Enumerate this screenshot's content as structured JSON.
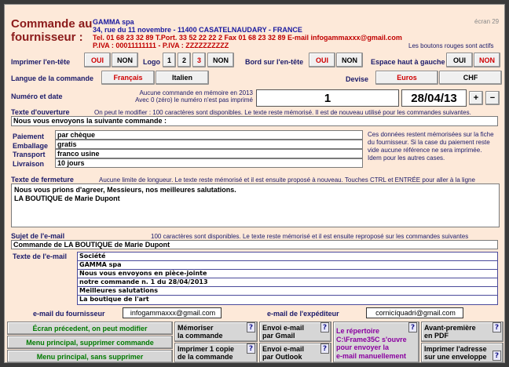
{
  "header": {
    "title_line1": "Commande au",
    "title_line2": "fournisseur :",
    "company": "GAMMA spa",
    "address": "34, rue du 11 novembre - 11400  CASATELNAUDARY  -  FRANCE",
    "phones": "Tel. 01 68 23 32 89   T.Port. 33 52 22 22 2   Fax 01 68 23 32 89    E-mail infogammaxxx@gmail.com",
    "piva": "P.IVA : 00011111111    -   P.IVA : ZZZZZZZZZZ",
    "screen_no": "écran 29",
    "red_note": "Les boutons rouges sont actifs"
  },
  "options": {
    "print_header_label": "Imprimer l'en-tête",
    "oui": "OUI",
    "non": "NON",
    "logo_label": "Logo",
    "logo_1": "1",
    "logo_2": "2",
    "logo_3": "3",
    "border_label": "Bord sur l'en-tête",
    "space_label": "Espace haut à gauche",
    "lang_label": "Langue de la commande",
    "lang_fr": "Français",
    "lang_it": "Italien",
    "devise_label": "Devise",
    "euros": "Euros",
    "chf": "CHF"
  },
  "number": {
    "label": "Numéro et date",
    "note1": "Aucune commande en mémoire en 2013",
    "note2": "Avec 0 (zéro) le numéro n'est pas imprimé",
    "value": "1",
    "date": "28/04/13",
    "plus": "+",
    "minus": "−"
  },
  "opening": {
    "label": "Texte d'ouverture",
    "hint": "On peut le modifier : 100 caractères sont disponibles. Le texte reste mémorisé. Il est de nouveau utilisé pour les commandes suivantes.",
    "value": "Nous vous envoyons la suivante commande  :"
  },
  "terms": {
    "rows": [
      {
        "label": "Paiement",
        "value": "par chèque"
      },
      {
        "label": "Emballage",
        "value": "gratis"
      },
      {
        "label": "Transport",
        "value": "franco usine"
      },
      {
        "label": "Livraison",
        "value": "10 jours"
      }
    ],
    "note": "Ces données restent mémorisées sur la fiche du fournisseur. Si la case du paiement reste vide aucune référence ne sera imprimée.\nIdem pour les autres cases."
  },
  "closing": {
    "label": "Texte de fermeture",
    "hint": "Aucune limite de longueur. Le texte reste mémorisé et il est ensuite proposé à nouveau. Touches CTRL et ENTRÉE pour aller à la ligne",
    "line1": "Nous vous prions d'agreer, Messieurs, nos meilleures salutations.",
    "line2": "LA BOUTIQUE de Marie Dupont"
  },
  "email": {
    "subject_label": "Sujet de l'e-mail",
    "subject_hint": "100 caractères sont disponibles. Le texte reste mémorisé et il est ensuite reproposé sur les commandes suivantes",
    "subject": "Commande de LA BOUTIQUE de Marie Dupont",
    "body_label": "Texte de l'e-mail",
    "body_lines": [
      "Société",
      "GAMMA spa",
      "Nous vous envoyons en pièce-jointe",
      "notre commande n. 1 du 28/04/2013",
      "Meilleures salutations",
      "La boutique de l'art"
    ],
    "supplier_label": "e-mail du fournisseur",
    "supplier": "infogammaxxx@gmail.com",
    "sender_label": "e-mail de l'expéditeur",
    "sender": "cornicíquadri@gmail.com"
  },
  "buttons": {
    "prev": "Écran précedent, on peut modifier",
    "menu_del": "Menu principal, supprimer commande",
    "menu_nodel": "Menu principal, sans supprimer",
    "memorize1": "Mémoriser",
    "memorize2": "la commande",
    "print1": "Imprimer 1 copie",
    "print2": "de la commande",
    "gmail1": "Envoi e-mail",
    "gmail2": "par Gmail",
    "outlook1": "Envoi e-mail",
    "outlook2": "par Outlook",
    "dir1": "Le répertoire",
    "dir2": "C:\\Frame35C s'ouvre",
    "dir3": "pour envoyer la",
    "dir4": "e-mail manuellement",
    "preview1": "Avant-première",
    "preview2": "en PDF",
    "envelope1": "Imprimer l'adresse",
    "envelope2": "sur une enveloppe",
    "help": "?"
  }
}
